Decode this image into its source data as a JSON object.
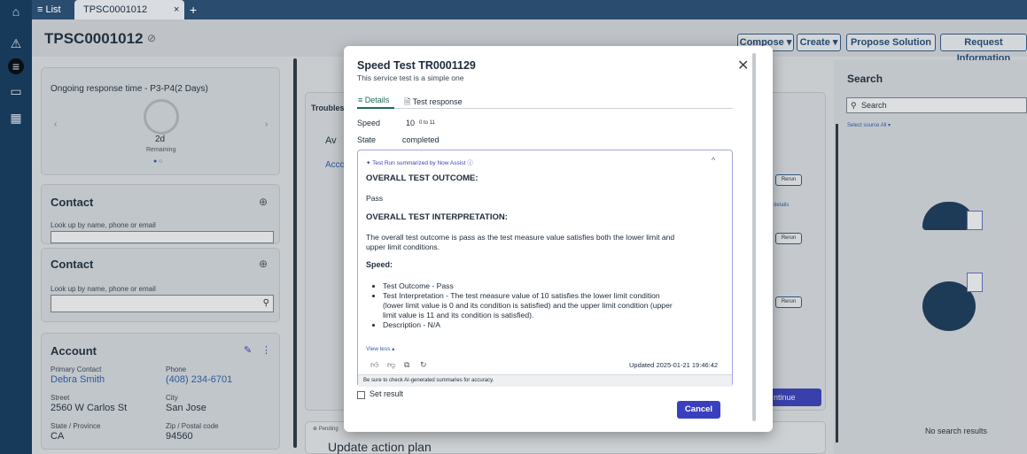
{
  "tabbar": {
    "list_label": "≡ List",
    "record_tab": "TPSC0001012",
    "close": "×",
    "add": "+"
  },
  "header": {
    "title": "TPSC0001012",
    "compose": "Compose ▾",
    "create": "Create ▾",
    "propose": "Propose Solution",
    "request": "Request Information"
  },
  "response_card": {
    "title": "Ongoing response time - P3-P4(2 Days)",
    "value": "2d",
    "sub": "Remaining"
  },
  "contact1": {
    "title": "Contact",
    "hint": "Look up by name, phone or email"
  },
  "contact2": {
    "title": "Contact",
    "hint": "Look up by name, phone or email"
  },
  "account": {
    "title": "Account",
    "primary_label": "Primary Contact",
    "primary": "Debra Smith",
    "phone_label": "Phone",
    "phone": "(408) 234-6701",
    "street_label": "Street",
    "street": "2560 W Carlos St",
    "city_label": "City",
    "city": "San Jose",
    "state_label": "State / Province",
    "state": "CA",
    "zip_label": "Zip / Postal code",
    "zip": "94560"
  },
  "middle": {
    "troubles": "Troubles",
    "av": "Av",
    "acco": "Acco",
    "rerun": "Rerun",
    "details": "details",
    "continue": "ntinue",
    "pending": "⊕ Pending",
    "update_plan": "Update action plan"
  },
  "search": {
    "title": "Search",
    "placeholder": "Search",
    "source": "Select source All ▾",
    "none": "No search results"
  },
  "modal": {
    "title": "Speed Test TR0001129",
    "subtitle": "This service test is a simple one",
    "tab_details": "Details",
    "tab_response": "Test response",
    "speed_label": "Speed",
    "speed_value": "10",
    "speed_range": "0 to 11",
    "state_label": "State",
    "state_value": "completed",
    "summary_header": "Test Run summarized by Now Assist",
    "outcome_heading": "OVERALL TEST OUTCOME:",
    "outcome": "Pass",
    "interp_heading": "OVERALL TEST INTERPRETATION:",
    "interp_line1": "The overall test outcome is pass as the test measure value satisfies both the lower limit and",
    "interp_line2": "upper limit conditions.",
    "speed_heading": "Speed:",
    "bullets": [
      "Test Outcome - Pass",
      "Test Interpretation - The test measure value of 10 satisfies the lower limit condition",
      "(lower limit value is 0 and its condition is satisfied) and the upper limit condition (upper",
      "limit value is 11 and its condition is satisfied).",
      "Description - N/A"
    ],
    "view_less": "View less ▴",
    "updated": "Updated 2025-01-21 19:46:42",
    "disclaimer": "Be sure to check AI-generated summaries for accuracy.",
    "set_result": "Set result",
    "cancel": "Cancel"
  },
  "colors": {
    "rail": "#17395a",
    "accent": "#3b3fb8",
    "cancel_bg": "#3a3fc0"
  }
}
